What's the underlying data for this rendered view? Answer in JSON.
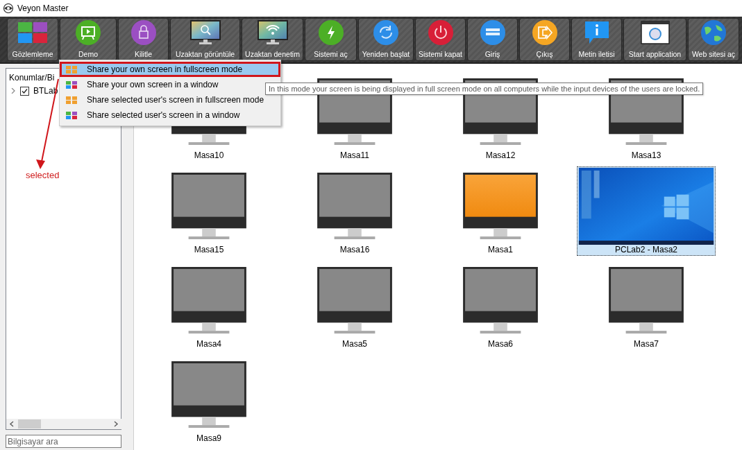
{
  "window": {
    "title": "Veyon Master"
  },
  "toolbar": {
    "buttons": [
      {
        "label": "Gözlemleme"
      },
      {
        "label": "Demo"
      },
      {
        "label": "Kilitle"
      },
      {
        "label": "Uzaktan görüntüle"
      },
      {
        "label": "Uzaktan denetim"
      },
      {
        "label": "Sistemi aç"
      },
      {
        "label": "Yeniden başlat"
      },
      {
        "label": "Sistemi kapat"
      },
      {
        "label": "Giriş"
      },
      {
        "label": "Çıkış"
      },
      {
        "label": "Metin iletisi"
      },
      {
        "label": "Start application"
      },
      {
        "label": "Web sitesi aç"
      }
    ]
  },
  "sidebar": {
    "header": "Konumlar/Bi",
    "tree": [
      {
        "label": "BTLab",
        "checked": true,
        "expanded": false
      }
    ],
    "search": {
      "placeholder": "Bilgisayar ara"
    }
  },
  "computers": [
    {
      "label": "Masa10",
      "kind": "off",
      "selected": false
    },
    {
      "label": "Masa11",
      "kind": "off",
      "selected": false
    },
    {
      "label": "Masa12",
      "kind": "off",
      "selected": false
    },
    {
      "label": "Masa13",
      "kind": "off",
      "selected": false
    },
    {
      "label": "Masa15",
      "kind": "off",
      "selected": false
    },
    {
      "label": "Masa16",
      "kind": "off",
      "selected": false
    },
    {
      "label": "Masa1",
      "kind": "locked",
      "selected": false
    },
    {
      "label": "PCLab2 - Masa2",
      "kind": "desktop",
      "selected": true
    },
    {
      "label": "Masa4",
      "kind": "off",
      "selected": false
    },
    {
      "label": "Masa5",
      "kind": "off",
      "selected": false
    },
    {
      "label": "Masa6",
      "kind": "off",
      "selected": false
    },
    {
      "label": "Masa7",
      "kind": "off",
      "selected": false
    },
    {
      "label": "Masa9",
      "kind": "off",
      "selected": false
    }
  ],
  "demo_menu": {
    "items": [
      {
        "label": "Share your own screen in fullscreen mode",
        "selected": true
      },
      {
        "label": "Share your own screen in a window",
        "selected": false
      },
      {
        "label": "Share selected user's screen in fullscreen mode",
        "selected": false
      },
      {
        "label": "Share selected user's screen in a window",
        "selected": false
      }
    ]
  },
  "tooltip": {
    "text": "In this mode your screen is being displayed in full screen mode on all computers while the input devices of the users are locked."
  },
  "annotation": {
    "text": "selected"
  }
}
